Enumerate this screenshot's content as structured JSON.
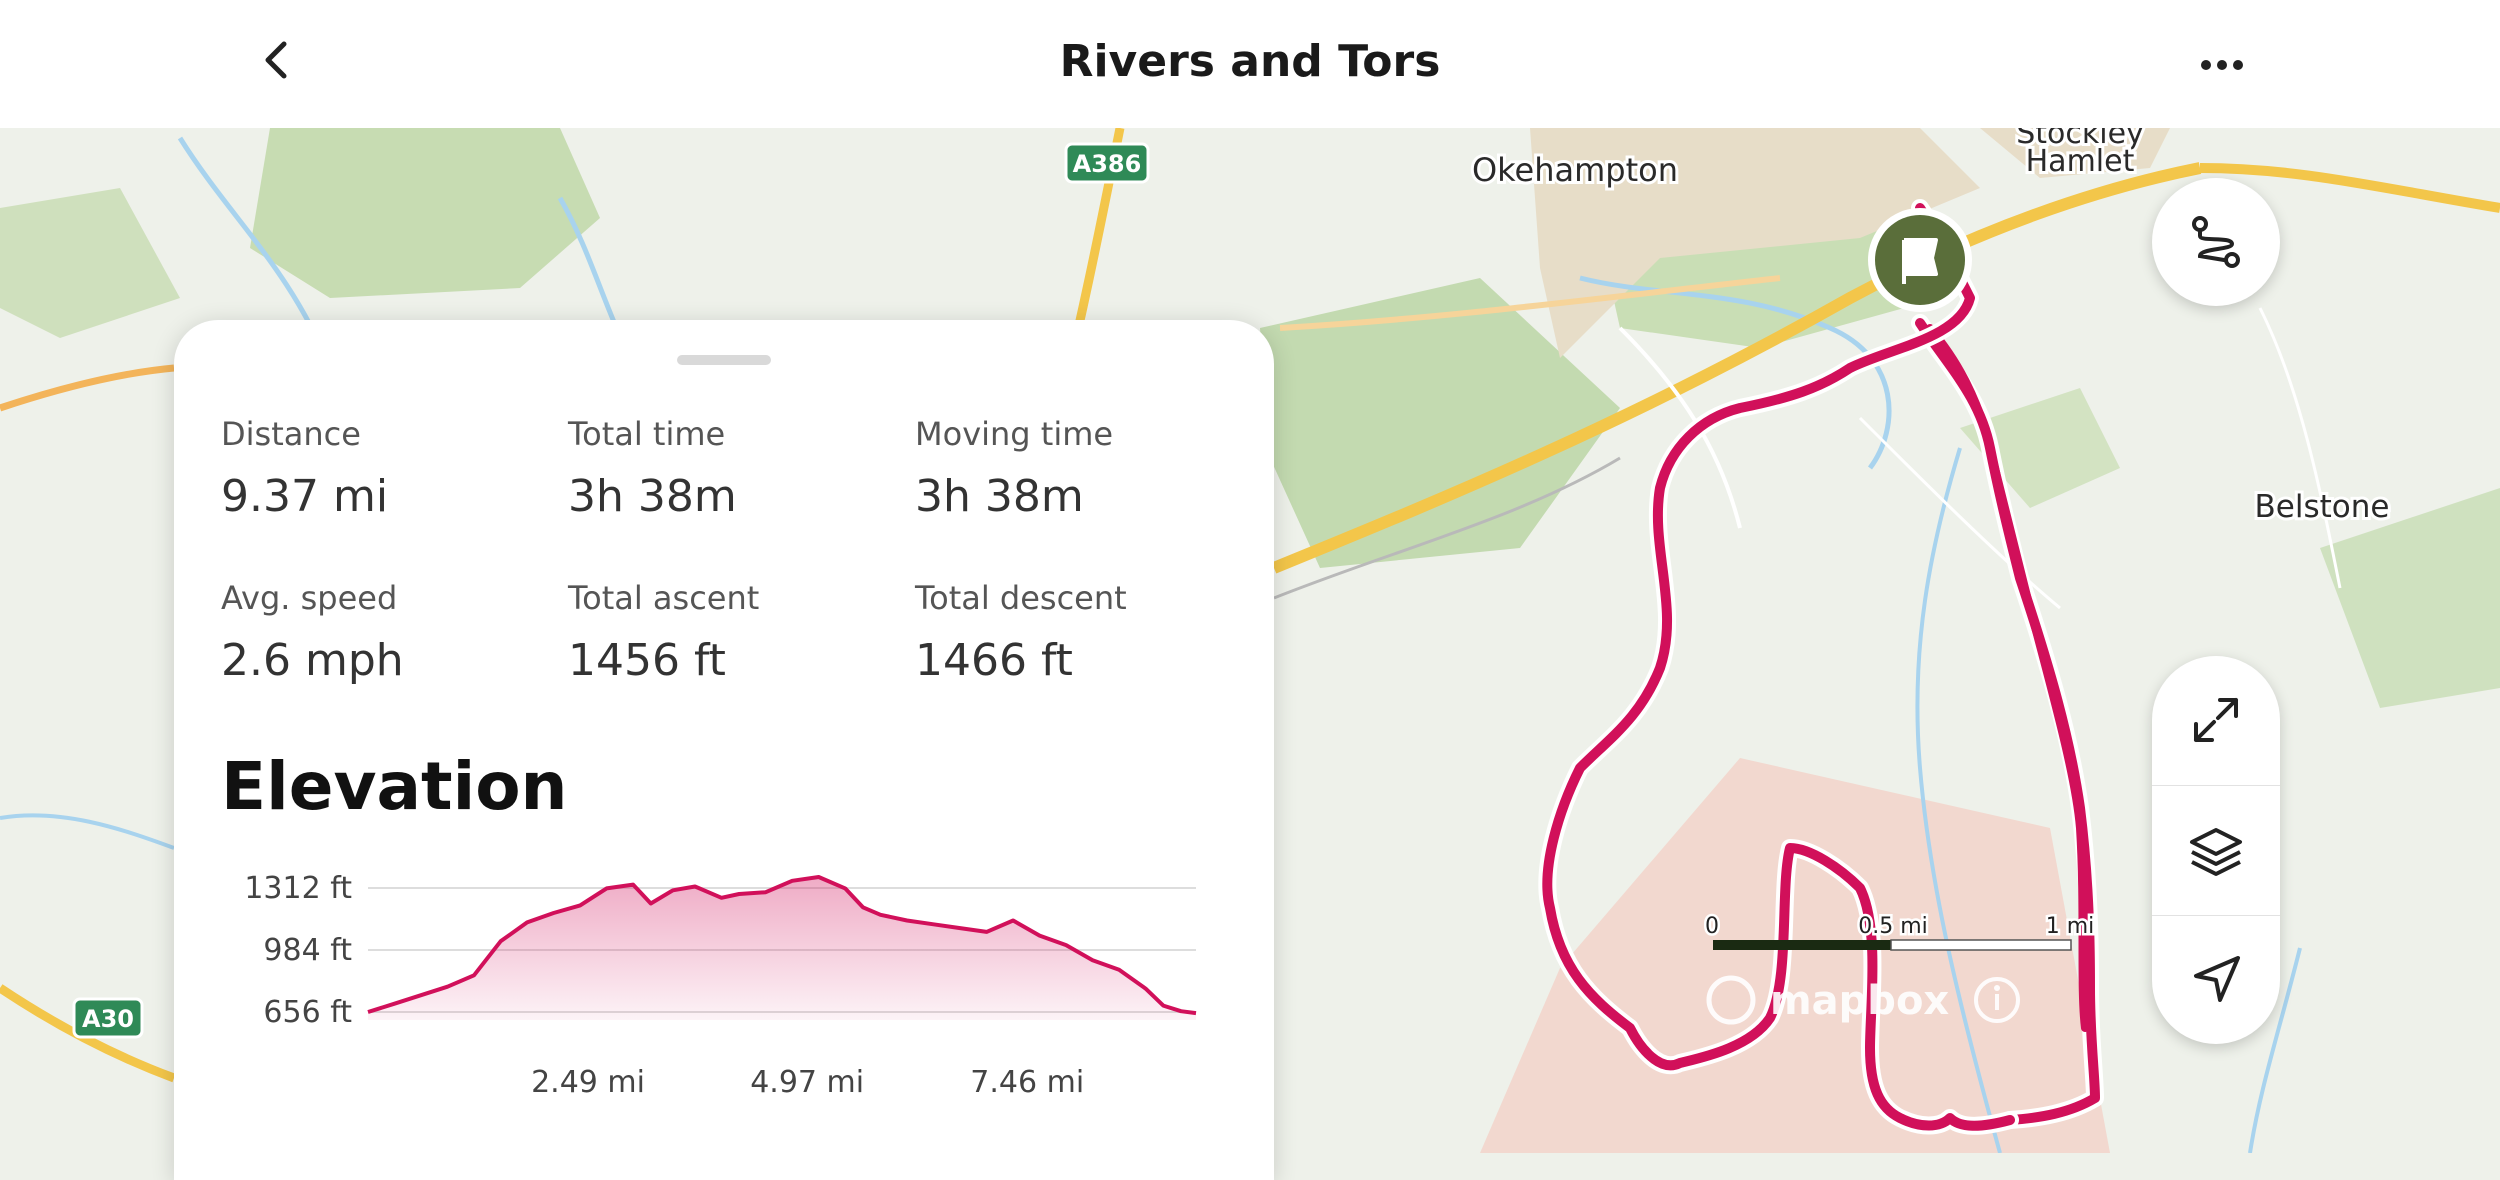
{
  "header": {
    "title": "Rivers and Tors"
  },
  "map": {
    "place_labels": {
      "okehampton": "Okehampton",
      "stockley": "Stockley",
      "hamlet": "Hamlet",
      "belstone": "Belstone"
    },
    "road_labels": {
      "a386": "A386",
      "a30": "A30"
    },
    "scale": {
      "zero": "0",
      "half": "0.5 mi",
      "one": "1 mi"
    },
    "attribution": "mapbox",
    "colors": {
      "route": "#d1105a",
      "start_marker": "#5a6e3a"
    }
  },
  "stats": {
    "distance": {
      "label": "Distance",
      "value": "9.37 mi"
    },
    "total_time": {
      "label": "Total time",
      "value": "3h 38m"
    },
    "moving_time": {
      "label": "Moving time",
      "value": "3h 38m"
    },
    "avg_speed": {
      "label": "Avg. speed",
      "value": "2.6 mph"
    },
    "total_ascent": {
      "label": "Total ascent",
      "value": "1456 ft"
    },
    "total_descent": {
      "label": "Total descent",
      "value": "1466 ft"
    }
  },
  "elevation": {
    "title": "Elevation"
  },
  "chart_data": {
    "type": "area",
    "ytick_labels": [
      "1312 ft",
      "984 ft",
      "656 ft"
    ],
    "yticks": [
      1312,
      984,
      656
    ],
    "xtick_labels": [
      "2.49 mi",
      "4.97 mi",
      "7.46 mi"
    ],
    "xticks": [
      2.49,
      4.97,
      7.46
    ],
    "xlim": [
      0,
      9.37
    ],
    "ylim": [
      656,
      1312
    ],
    "series": [
      {
        "x": [
          0,
          0.3,
          0.6,
          0.9,
          1.2,
          1.5,
          1.8,
          2.1,
          2.4,
          2.7,
          3.0,
          3.2,
          3.45,
          3.7,
          4.0,
          4.2,
          4.5,
          4.8,
          5.1,
          5.4,
          5.6,
          5.8,
          6.1,
          6.4,
          6.7,
          7.0,
          7.3,
          7.6,
          7.9,
          8.2,
          8.5,
          8.8,
          9.0,
          9.2,
          9.37
        ],
        "y": [
          656,
          700,
          745,
          790,
          850,
          1030,
          1130,
          1180,
          1220,
          1310,
          1330,
          1230,
          1300,
          1320,
          1260,
          1280,
          1290,
          1350,
          1370,
          1310,
          1210,
          1170,
          1140,
          1120,
          1100,
          1080,
          1140,
          1060,
          1010,
          930,
          880,
          780,
          690,
          660,
          650
        ]
      }
    ]
  }
}
